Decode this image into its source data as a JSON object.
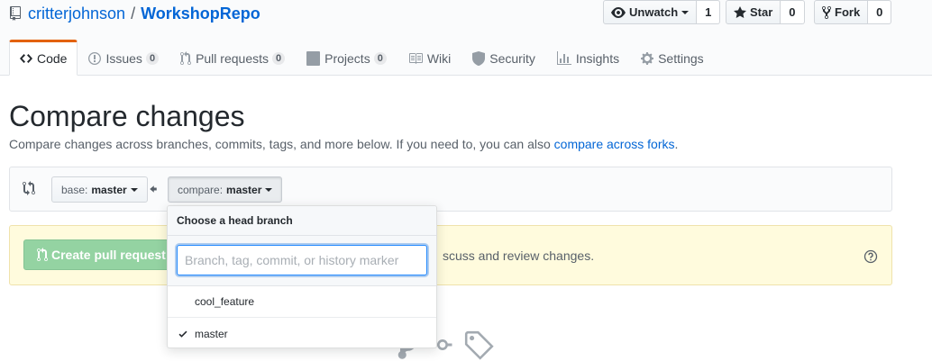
{
  "repo": {
    "owner": "critterjohnson",
    "separator": "/",
    "name": "WorkshopRepo",
    "icon": "repo-book-icon"
  },
  "actions": {
    "watch": {
      "label": "Unwatch",
      "count": "1",
      "icon": "eye-icon"
    },
    "star": {
      "label": "Star",
      "count": "0",
      "icon": "star-icon"
    },
    "fork": {
      "label": "Fork",
      "count": "0",
      "icon": "fork-icon"
    }
  },
  "nav": {
    "code": {
      "label": "Code",
      "icon": "code-icon"
    },
    "issues": {
      "label": "Issues",
      "count": "0",
      "icon": "issue-icon"
    },
    "pulls": {
      "label": "Pull requests",
      "count": "0",
      "icon": "pull-request-icon"
    },
    "projects": {
      "label": "Projects",
      "count": "0",
      "icon": "project-icon"
    },
    "wiki": {
      "label": "Wiki",
      "icon": "book-icon"
    },
    "security": {
      "label": "Security",
      "icon": "shield-icon"
    },
    "insights": {
      "label": "Insights",
      "icon": "graph-icon"
    },
    "settings": {
      "label": "Settings",
      "icon": "gear-icon"
    }
  },
  "compare": {
    "title": "Compare changes",
    "description": "Compare changes across branches, commits, tags, and more below. If you need to, you can also",
    "link": "compare across forks",
    "description_end": ".",
    "base_prefix": "base:",
    "base_value": "master",
    "compare_prefix": "compare:",
    "compare_value": "master"
  },
  "flash": {
    "button": "Create pull request",
    "text": "scuss and review changes."
  },
  "dropdown": {
    "header": "Choose a head branch",
    "placeholder": "Branch, tag, commit, or history marker",
    "items": [
      {
        "label": "cool_feature",
        "selected": false
      },
      {
        "label": "master",
        "selected": true
      }
    ]
  },
  "colors": {
    "link": "#0366d6",
    "accent_tab": "#e36209",
    "create_button": "#94d3a2",
    "flash_bg": "#fffbdd"
  }
}
